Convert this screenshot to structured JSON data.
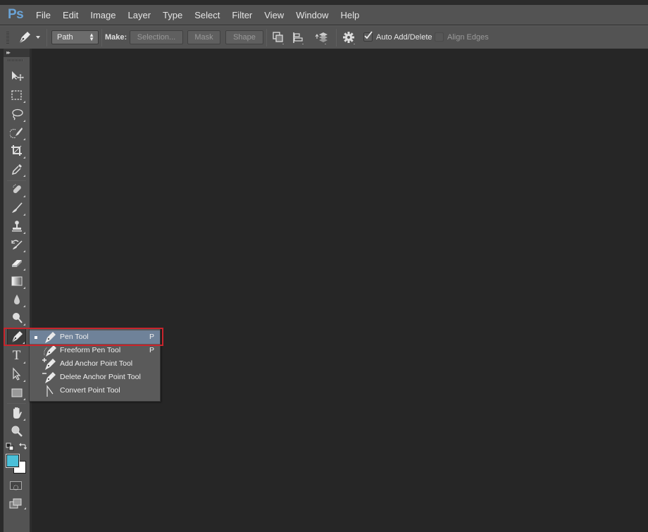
{
  "app": {
    "logo": "Ps",
    "name": "Adobe Photoshop"
  },
  "menubar": {
    "items": [
      "File",
      "Edit",
      "Image",
      "Layer",
      "Type",
      "Select",
      "Filter",
      "View",
      "Window",
      "Help"
    ]
  },
  "options_bar": {
    "tool_preset_icon": "pen-icon",
    "mode_select": {
      "value": "Path"
    },
    "make_label": "Make:",
    "buttons": {
      "selection": "Selection...",
      "mask": "Mask",
      "shape": "Shape"
    },
    "icon_buttons": [
      "path-operations-icon",
      "path-alignment-icon",
      "path-arrangement-icon",
      "gear-icon"
    ],
    "auto_add_delete": {
      "label": "Auto Add/Delete",
      "checked": true
    },
    "align_edges": {
      "label": "Align Edges",
      "checked": false,
      "enabled": false
    }
  },
  "toolbar": {
    "collapse_label": "▸▸",
    "tools": [
      {
        "name": "move-tool",
        "icon": "move-icon"
      },
      {
        "name": "rectangular-marquee-tool",
        "icon": "marquee-icon"
      },
      {
        "name": "lasso-tool",
        "icon": "lasso-icon"
      },
      {
        "name": "quick-selection-tool",
        "icon": "quick-selection-icon"
      },
      {
        "name": "crop-tool",
        "icon": "crop-icon"
      },
      {
        "name": "eyedropper-tool",
        "icon": "eyedropper-icon"
      },
      {
        "name": "spot-healing-brush-tool",
        "icon": "bandage-icon"
      },
      {
        "name": "brush-tool",
        "icon": "brush-icon"
      },
      {
        "name": "clone-stamp-tool",
        "icon": "stamp-icon"
      },
      {
        "name": "history-brush-tool",
        "icon": "history-brush-icon"
      },
      {
        "name": "eraser-tool",
        "icon": "eraser-icon"
      },
      {
        "name": "gradient-tool",
        "icon": "gradient-icon"
      },
      {
        "name": "blur-tool",
        "icon": "drop-icon"
      },
      {
        "name": "dodge-tool",
        "icon": "dodge-icon"
      },
      {
        "name": "pen-tool",
        "icon": "pen-icon",
        "active": true
      },
      {
        "name": "type-tool",
        "icon": "type-icon",
        "glyph": "T"
      },
      {
        "name": "path-selection-tool",
        "icon": "direct-select-arrow-icon"
      },
      {
        "name": "rectangle-tool",
        "icon": "rectangle-icon"
      },
      {
        "name": "hand-tool",
        "icon": "hand-icon"
      },
      {
        "name": "zoom-tool",
        "icon": "magnifier-icon"
      }
    ],
    "colors": {
      "foreground": "#4bc0d9",
      "background": "#ffffff"
    }
  },
  "flyout": {
    "items": [
      {
        "label": "Pen Tool",
        "shortcut": "P",
        "selected": true,
        "icon": "pen-icon"
      },
      {
        "label": "Freeform Pen Tool",
        "shortcut": "P",
        "selected": false,
        "icon": "freeform-pen-icon"
      },
      {
        "label": "Add Anchor Point Tool",
        "shortcut": "",
        "selected": false,
        "icon": "add-anchor-point-icon"
      },
      {
        "label": "Delete Anchor Point Tool",
        "shortcut": "",
        "selected": false,
        "icon": "delete-anchor-point-icon"
      },
      {
        "label": "Convert Point Tool",
        "shortcut": "",
        "selected": false,
        "icon": "convert-point-icon"
      }
    ]
  },
  "annotation": {
    "highlight_color": "#c8242c"
  }
}
